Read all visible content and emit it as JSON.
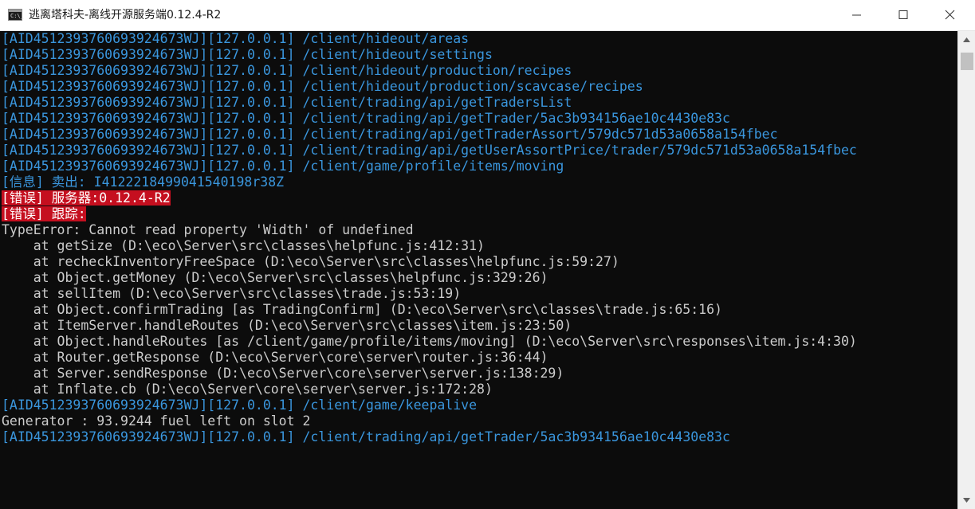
{
  "window": {
    "title": "逃离塔科夫-离线开源服务端0.12.4-R2",
    "icon_text": "C:\\_"
  },
  "console": {
    "lines": [
      {
        "type": "route",
        "prefix": "[AID4512393760693924673WJ][127.0.0.1] ",
        "path": "/client/hideout/areas"
      },
      {
        "type": "route",
        "prefix": "[AID4512393760693924673WJ][127.0.0.1] ",
        "path": "/client/hideout/settings"
      },
      {
        "type": "route",
        "prefix": "[AID4512393760693924673WJ][127.0.0.1] ",
        "path": "/client/hideout/production/recipes"
      },
      {
        "type": "route",
        "prefix": "[AID4512393760693924673WJ][127.0.0.1] ",
        "path": "/client/hideout/production/scavcase/recipes"
      },
      {
        "type": "route",
        "prefix": "[AID4512393760693924673WJ][127.0.0.1] ",
        "path": "/client/trading/api/getTradersList"
      },
      {
        "type": "route",
        "prefix": "[AID4512393760693924673WJ][127.0.0.1] ",
        "path": "/client/trading/api/getTrader/5ac3b934156ae10c4430e83c"
      },
      {
        "type": "route",
        "prefix": "[AID4512393760693924673WJ][127.0.0.1] ",
        "path": "/client/trading/api/getTraderAssort/579dc571d53a0658a154fbec"
      },
      {
        "type": "route",
        "prefix": "[AID4512393760693924673WJ][127.0.0.1] ",
        "path": "/client/trading/api/getUserAssortPrice/trader/579dc571d53a0658a154fbec"
      },
      {
        "type": "route",
        "prefix": "[AID4512393760693924673WJ][127.0.0.1] ",
        "path": "/client/game/profile/items/moving"
      },
      {
        "type": "info",
        "text": "[信息] 卖出: I4122218499041540198r38Z"
      },
      {
        "type": "error",
        "label": "[错误]",
        "text": " 服务器:0.12.4-R2"
      },
      {
        "type": "error",
        "label": "[错误]",
        "text": " 跟踪:"
      },
      {
        "type": "plain",
        "text": "TypeError: Cannot read property 'Width' of undefined"
      },
      {
        "type": "plain",
        "text": "    at getSize (D:\\eco\\Server\\src\\classes\\helpfunc.js:412:31)"
      },
      {
        "type": "plain",
        "text": "    at recheckInventoryFreeSpace (D:\\eco\\Server\\src\\classes\\helpfunc.js:59:27)"
      },
      {
        "type": "plain",
        "text": "    at Object.getMoney (D:\\eco\\Server\\src\\classes\\helpfunc.js:329:26)"
      },
      {
        "type": "plain",
        "text": "    at sellItem (D:\\eco\\Server\\src\\classes\\trade.js:53:19)"
      },
      {
        "type": "plain",
        "text": "    at Object.confirmTrading [as TradingConfirm] (D:\\eco\\Server\\src\\classes\\trade.js:65:16)"
      },
      {
        "type": "plain",
        "text": "    at ItemServer.handleRoutes (D:\\eco\\Server\\src\\classes\\item.js:23:50)"
      },
      {
        "type": "plain",
        "text": "    at Object.handleRoutes [as /client/game/profile/items/moving] (D:\\eco\\Server\\src\\responses\\item.js:4:30)"
      },
      {
        "type": "plain",
        "text": "    at Router.getResponse (D:\\eco\\Server\\core\\server\\router.js:36:44)"
      },
      {
        "type": "plain",
        "text": "    at Server.sendResponse (D:\\eco\\Server\\core\\server\\server.js:138:29)"
      },
      {
        "type": "plain",
        "text": "    at Inflate.cb (D:\\eco\\Server\\core\\server\\server.js:172:28)"
      },
      {
        "type": "route",
        "prefix": "[AID4512393760693924673WJ][127.0.0.1] ",
        "path": "/client/game/keepalive"
      },
      {
        "type": "plain",
        "text": "Generator : 93.9244 fuel left on slot 2"
      },
      {
        "type": "route",
        "prefix": "[AID4512393760693924673WJ][127.0.0.1] ",
        "path": "/client/trading/api/getTrader/5ac3b934156ae10c4430e83c"
      }
    ]
  },
  "colors": {
    "background": "#0c0c0c",
    "text": "#cccccc",
    "route": "#3a96dd",
    "error_bg": "#c50f1f"
  },
  "icons": [
    "console-app-icon",
    "minimize-icon",
    "maximize-icon",
    "close-icon",
    "scroll-up-arrow-icon",
    "scroll-down-arrow-icon"
  ]
}
